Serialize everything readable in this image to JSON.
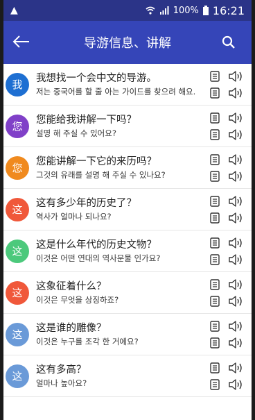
{
  "status": {
    "battery": "100%",
    "time": "16:21"
  },
  "appbar": {
    "title": "导游信息、讲解",
    "back_icon": "back-arrow-icon",
    "search_icon": "search-icon"
  },
  "colors": {
    "statusbar": "#2b3488",
    "appbar": "#3545b8"
  },
  "phrases": [
    {
      "avatar": "我",
      "color": "#1e6fd2",
      "zh": "我想找一个会中文的导游。",
      "ko": "저는 중국어를 할 줄 아는 가이드를 찾으려 해요."
    },
    {
      "avatar": "您",
      "color": "#8040c8",
      "zh": "您能给我讲解一下吗？",
      "ko": "설명 해 주실 수 있어요?"
    },
    {
      "avatar": "您",
      "color": "#f08a1e",
      "zh": "您能讲解一下它的来历吗？",
      "ko": "그것의 유래를 설명 해 주실 수 있나요?"
    },
    {
      "avatar": "这",
      "color": "#f0583a",
      "zh": "这有多少年的历史了？",
      "ko": "역사가 얼마나 되나요?"
    },
    {
      "avatar": "这",
      "color": "#4cc97c",
      "zh": "这是什么年代的历史文物？",
      "ko": "이것은 어떤 연대의 역사문물 인가요?"
    },
    {
      "avatar": "这",
      "color": "#f0583a",
      "zh": "这象征着什么？",
      "ko": "이것은 무엇을 상징하죠?"
    },
    {
      "avatar": "这",
      "color": "#6a9ad8",
      "zh": "这是谁的雕像？",
      "ko": "이것은 누구를 조각 한 거에요?"
    },
    {
      "avatar": "这",
      "color": "#6a9ad8",
      "zh": "这有多高？",
      "ko": "얼마나 높아요?"
    }
  ]
}
